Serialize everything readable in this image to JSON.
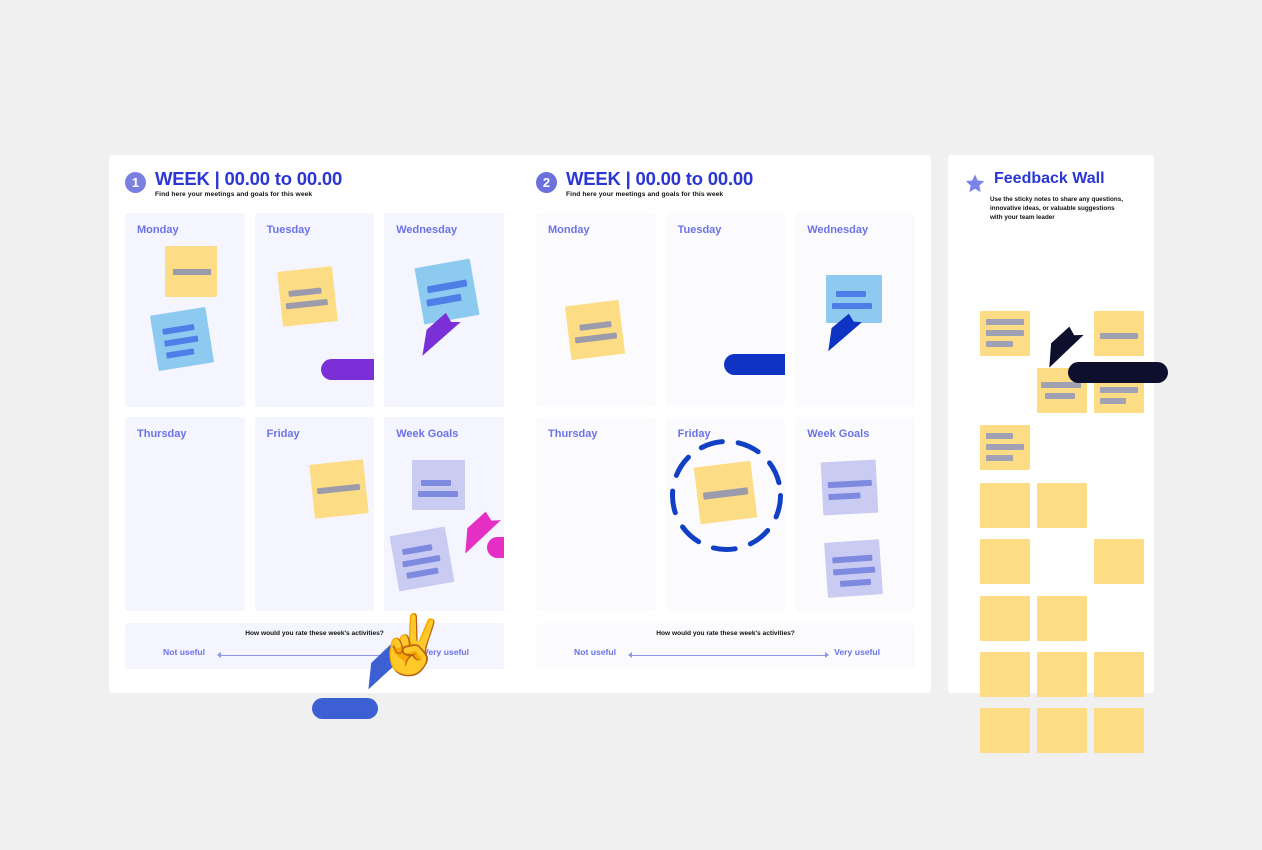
{
  "canvas": {
    "background": "#f0f0f0",
    "accent_blue": "#2b37d4",
    "day_label_color": "#6b73e5",
    "note_yellow": "#fcdc85",
    "note_blue": "#8ccbef",
    "note_lavender": "#c9cbf2"
  },
  "weeks": [
    {
      "badge": "1",
      "title": "WEEK | 00.00 to 00.00",
      "subtitle": "Find here your meetings and goals for this week",
      "days": [
        "Monday",
        "Tuesday",
        "Wednesday",
        "Thursday",
        "Friday",
        "Week Goals"
      ],
      "rating": {
        "question": "How would you rate these week's activities?",
        "left_label": "Not useful",
        "right_label": "Very useful"
      }
    },
    {
      "badge": "2",
      "title": "WEEK | 00.00 to 00.00",
      "subtitle": "Find here your meetings and goals for this week",
      "days": [
        "Monday",
        "Tuesday",
        "Wednesday",
        "Thursday",
        "Friday",
        "Week Goals"
      ],
      "rating": {
        "question": "How would you rate these week's activities?",
        "left_label": "Not useful",
        "right_label": "Very useful"
      }
    }
  ],
  "feedback_wall": {
    "icon": "star-icon",
    "title": "Feedback Wall",
    "subtitle": "Use the sticky notes to share any questions, innovative ideas, or valuable suggestions with your team leader"
  },
  "cursors": [
    {
      "name": "purple-cursor",
      "color": "#7b2fd6",
      "label": ""
    },
    {
      "name": "pink-cursor",
      "color": "#e52fc4",
      "label": ""
    },
    {
      "name": "blue-cursor",
      "color": "#0f33c2",
      "label": ""
    },
    {
      "name": "royal-blue-cursor",
      "color": "#3d5fd4",
      "label": ""
    },
    {
      "name": "dark-navy-cursor",
      "color": "#0d0f2c",
      "label": ""
    }
  ],
  "reaction": {
    "emoji": "✌",
    "name": "victory-hand-emoji"
  },
  "selection": {
    "name": "dashed-selection-ring",
    "color": "#1240c4"
  }
}
